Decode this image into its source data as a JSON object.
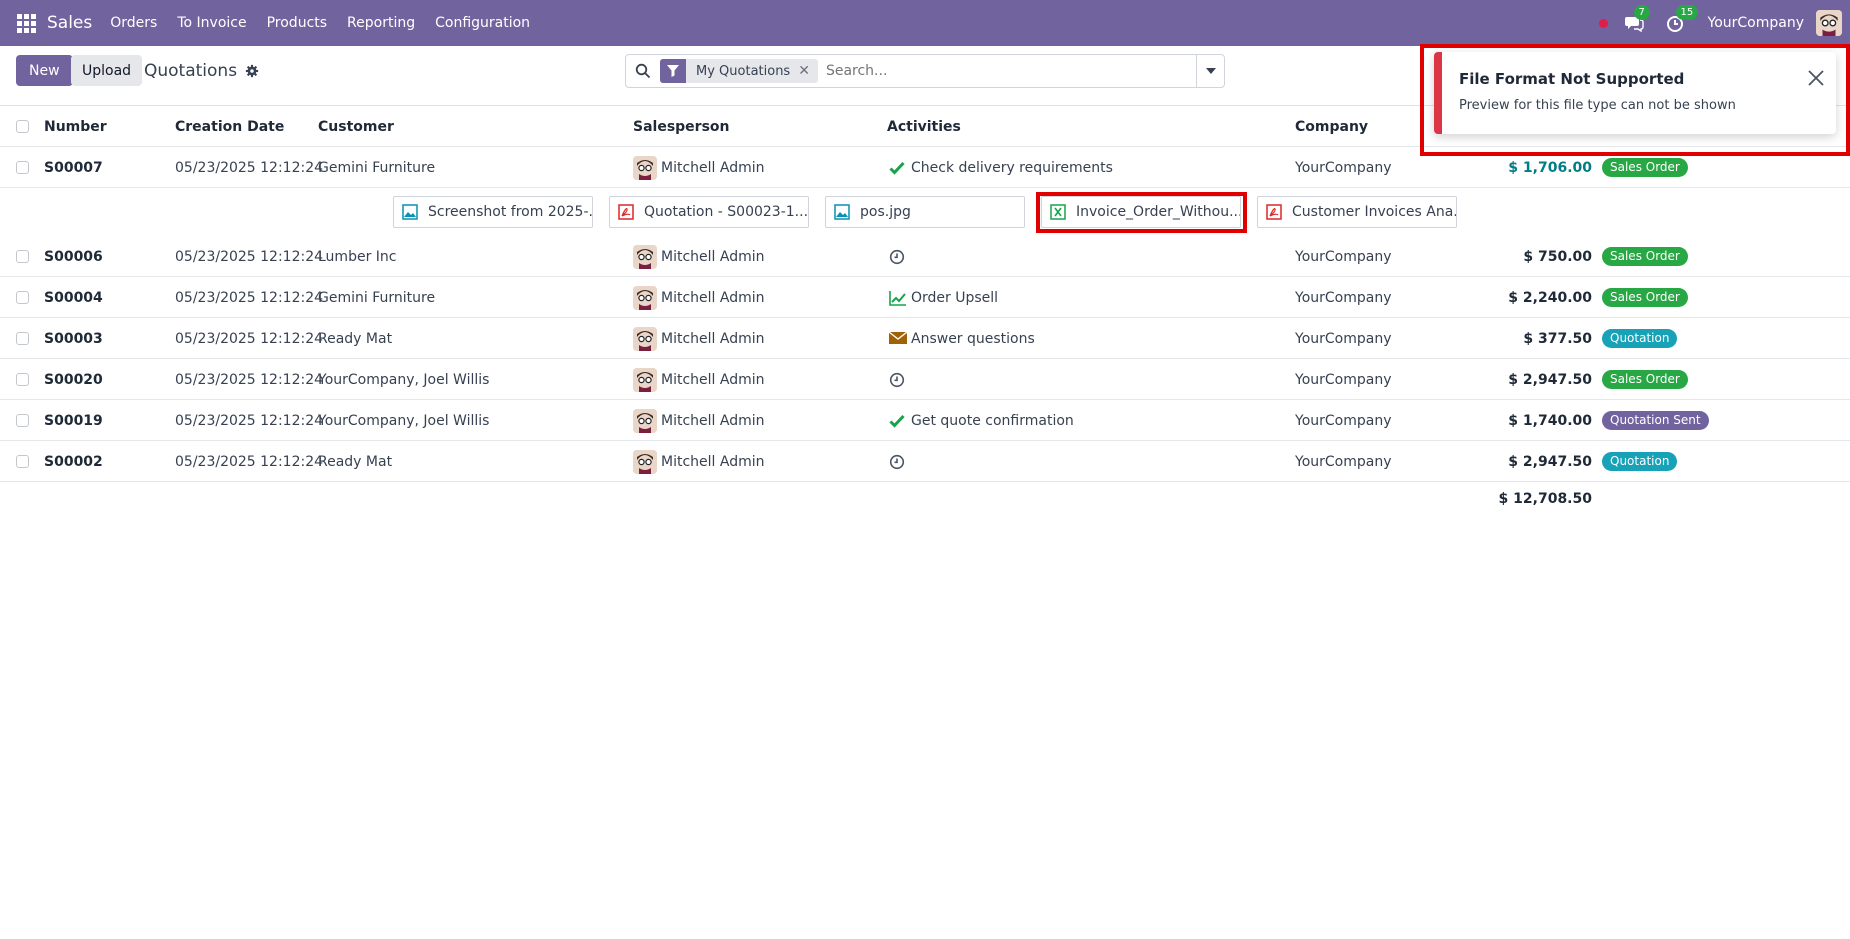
{
  "navbar": {
    "app_name": "Sales",
    "menu": [
      "Orders",
      "To Invoice",
      "Products",
      "Reporting",
      "Configuration"
    ],
    "messages_badge": "7",
    "activities_badge": "15",
    "company": "YourCompany",
    "bg_color": "#71639e"
  },
  "control_panel": {
    "new_label": "New",
    "upload_label": "Upload",
    "breadcrumb": "Quotations",
    "search": {
      "facet": "My Quotations",
      "placeholder": "Search..."
    }
  },
  "table": {
    "columns": [
      "Number",
      "Creation Date",
      "Customer",
      "Salesperson",
      "Activities",
      "Company"
    ],
    "rows": [
      {
        "number": "S00007",
        "date": "05/23/2025 12:12:24",
        "customer": "Gemini Furniture",
        "salesperson": "Mitchell Admin",
        "activity_icon": "check-icon",
        "activity": "Check delivery requirements",
        "company": "YourCompany",
        "total": "$ 1,706.00",
        "status": "Sales Order"
      },
      {
        "number": "S00006",
        "date": "05/23/2025 12:12:24",
        "customer": "Lumber Inc",
        "salesperson": "Mitchell Admin",
        "activity_icon": "clock-icon",
        "activity": "",
        "company": "YourCompany",
        "total": "$ 750.00",
        "status": "Sales Order"
      },
      {
        "number": "S00004",
        "date": "05/23/2025 12:12:24",
        "customer": "Gemini Furniture",
        "salesperson": "Mitchell Admin",
        "activity_icon": "chart-line-icon",
        "activity": "Order Upsell",
        "company": "YourCompany",
        "total": "$ 2,240.00",
        "status": "Sales Order"
      },
      {
        "number": "S00003",
        "date": "05/23/2025 12:12:24",
        "customer": "Ready Mat",
        "salesperson": "Mitchell Admin",
        "activity_icon": "envelope-icon",
        "activity": "Answer questions",
        "company": "YourCompany",
        "total": "$ 377.50",
        "status": "Quotation"
      },
      {
        "number": "S00020",
        "date": "05/23/2025 12:12:24",
        "customer": "YourCompany, Joel Willis",
        "salesperson": "Mitchell Admin",
        "activity_icon": "clock-icon",
        "activity": "",
        "company": "YourCompany",
        "total": "$ 2,947.50",
        "status": "Sales Order"
      },
      {
        "number": "S00019",
        "date": "05/23/2025 12:12:24",
        "customer": "YourCompany, Joel Willis",
        "salesperson": "Mitchell Admin",
        "activity_icon": "check-icon",
        "activity": "Get quote confirmation",
        "company": "YourCompany",
        "total": "$ 1,740.00",
        "status": "Quotation Sent"
      },
      {
        "number": "S00002",
        "date": "05/23/2025 12:12:24",
        "customer": "Ready Mat",
        "salesperson": "Mitchell Admin",
        "activity_icon": "clock-icon",
        "activity": "",
        "company": "YourCompany",
        "total": "$ 2,947.50",
        "status": "Quotation"
      }
    ],
    "grand_total": "$ 12,708.50"
  },
  "status_colors": {
    "Sales Order": "#28a745",
    "Quotation": "#17a2b8",
    "Quotation Sent": "#71639e"
  },
  "attachments": [
    {
      "name": "Screenshot from 2025-...",
      "icon": "image-file-icon"
    },
    {
      "name": "Quotation - S00023-1....",
      "icon": "pdf-file-icon"
    },
    {
      "name": "pos.jpg",
      "icon": "image-file-icon"
    },
    {
      "name": "Invoice_Order_Withou...",
      "icon": "spreadsheet-file-icon"
    },
    {
      "name": "Customer Invoices Ana...",
      "icon": "pdf-file-icon"
    }
  ],
  "toast": {
    "title": "File Format Not Supported",
    "message": "Preview for this file type can not be shown",
    "accent": "#dc3545"
  }
}
